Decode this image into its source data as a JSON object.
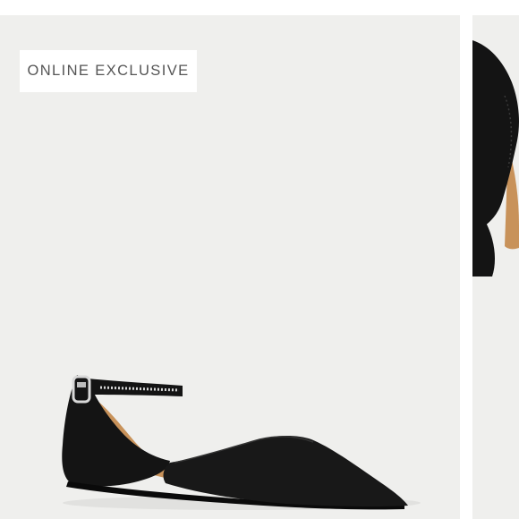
{
  "badge": {
    "label": "ONLINE EXCLUSIVE"
  },
  "product": {
    "main_image_icon": "black-suede-dorsay-flat-with-ankle-strap",
    "next_image_icon": "black-suede-flat-closeup",
    "colors": {
      "background": "#efefed",
      "shoe": "#141414",
      "lining": "#c8925a",
      "badge_bg": "#ffffff",
      "badge_text": "#555555"
    }
  }
}
